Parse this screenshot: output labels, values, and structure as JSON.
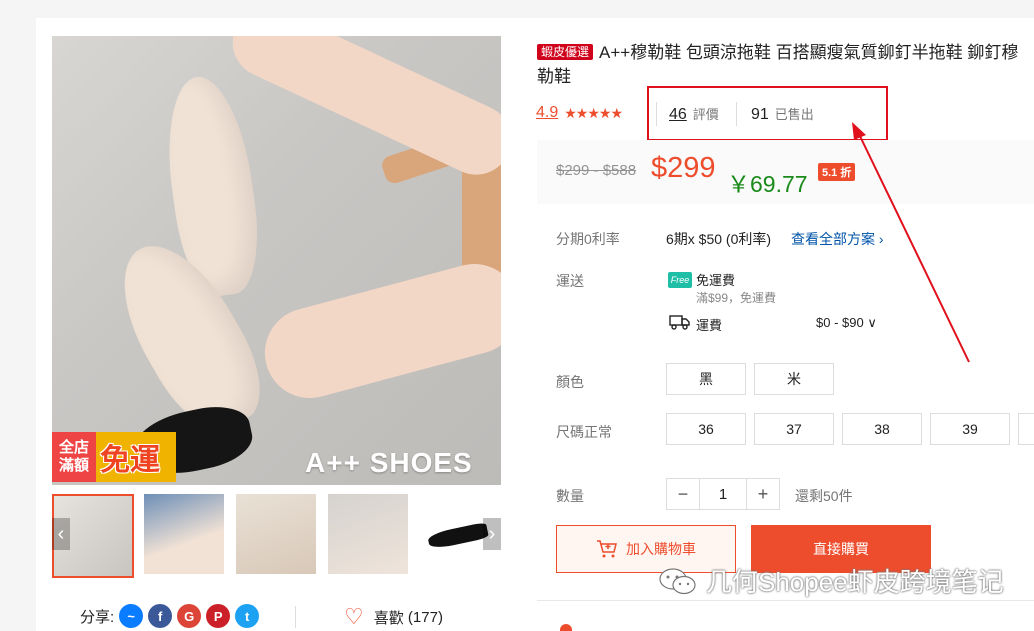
{
  "product": {
    "mall_badge": "蝦皮優選",
    "title": "A++穆勒鞋 包頭涼拖鞋 百搭顯瘦氣質鉚釘半拖鞋 鉚釘穆勒鞋",
    "rating": "4.9",
    "stars": "★★★★★",
    "reviews_count": "46",
    "reviews_label": "評價",
    "sold_count": "91",
    "sold_label": "已售出",
    "old_price": "$299 - $588",
    "price": "$299",
    "rmb_price": "￥69.77",
    "discount": "5.1 折"
  },
  "image": {
    "brand_mark": "A++ SHOES",
    "promo_left_1": "全店",
    "promo_left_2": "滿額",
    "promo_right": "免運"
  },
  "installment": {
    "label": "分期0利率",
    "value": "6期x $50 (0利率)",
    "link": "查看全部方案"
  },
  "shipping": {
    "label": "運送",
    "free_icon_text": "Free",
    "free_title": "免運費",
    "free_sub": "滿$99，免運費",
    "fee_label": "運費",
    "fee_range": "$0 - $90"
  },
  "color": {
    "label": "顏色",
    "options": [
      "黑",
      "米"
    ]
  },
  "size": {
    "label": "尺碼正常",
    "options": [
      "36",
      "37",
      "38",
      "39"
    ]
  },
  "quantity": {
    "label": "數量",
    "value": "1",
    "minus": "−",
    "plus": "+",
    "stock": "還剩50件"
  },
  "actions": {
    "add_to_cart": "加入購物車",
    "buy_now": "直接購買"
  },
  "share": {
    "label": "分享:",
    "like_label": "喜歡",
    "like_count": "(177)"
  },
  "watermark": "几何Shopee虾皮跨境笔记",
  "colors": {
    "accent": "#ee4d2d",
    "highlight": "#e0101c",
    "rmb": "#1a8a1a"
  }
}
